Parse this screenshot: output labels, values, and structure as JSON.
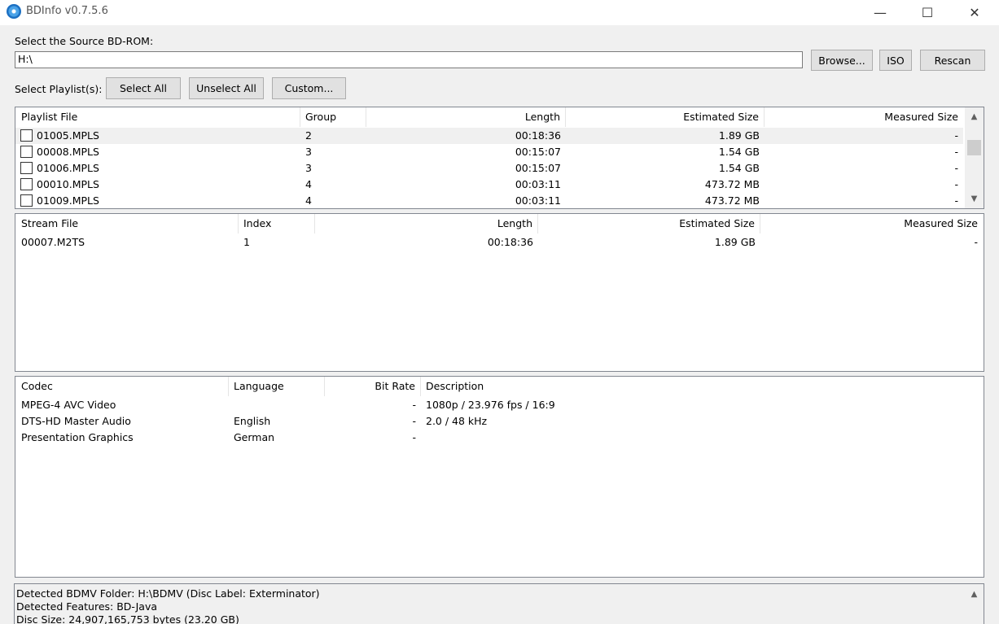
{
  "window": {
    "title": "BDInfo v0.7.5.6"
  },
  "source": {
    "label": "Select the Source BD-ROM:",
    "value": "H:\\",
    "browse": "Browse...",
    "iso": "ISO",
    "rescan": "Rescan"
  },
  "playlist_select": {
    "label": "Select Playlist(s):",
    "select_all": "Select All",
    "unselect_all": "Unselect All",
    "custom": "Custom..."
  },
  "playlists": {
    "headers": [
      "Playlist File",
      "Group",
      "Length",
      "Estimated Size",
      "Measured Size"
    ],
    "rows": [
      {
        "file": "01005.MPLS",
        "group": "2",
        "length": "00:18:36",
        "est": "1.89 GB",
        "meas": "-"
      },
      {
        "file": "00008.MPLS",
        "group": "3",
        "length": "00:15:07",
        "est": "1.54 GB",
        "meas": "-"
      },
      {
        "file": "01006.MPLS",
        "group": "3",
        "length": "00:15:07",
        "est": "1.54 GB",
        "meas": "-"
      },
      {
        "file": "00010.MPLS",
        "group": "4",
        "length": "00:03:11",
        "est": "473.72 MB",
        "meas": "-"
      },
      {
        "file": "01009.MPLS",
        "group": "4",
        "length": "00:03:11",
        "est": "473.72 MB",
        "meas": "-"
      }
    ]
  },
  "streams": {
    "headers": [
      "Stream File",
      "Index",
      "Length",
      "Estimated Size",
      "Measured Size"
    ],
    "rows": [
      {
        "file": "00007.M2TS",
        "index": "1",
        "length": "00:18:36",
        "est": "1.89 GB",
        "meas": "-"
      }
    ]
  },
  "codecs": {
    "headers": [
      "Codec",
      "Language",
      "Bit Rate",
      "Description"
    ],
    "rows": [
      {
        "codec": "MPEG-4 AVC Video",
        "lang": "",
        "rate": "-",
        "desc": "1080p / 23.976 fps / 16:9"
      },
      {
        "codec": "DTS-HD Master Audio",
        "lang": "English",
        "rate": "-",
        "desc": "2.0 / 48 kHz"
      },
      {
        "codec": "Presentation Graphics",
        "lang": "German",
        "rate": "-",
        "desc": ""
      }
    ]
  },
  "status": {
    "lines": [
      "Detected BDMV Folder: H:\\BDMV (Disc Label: Exterminator)",
      "Detected Features: BD-Java",
      "Disc Size: 24,907,165,753 bytes (23.20 GB)"
    ]
  },
  "icons": {
    "app": "bdinfo-disc-icon",
    "minimize": "—",
    "maximize": "☐",
    "close": "✕",
    "up": "▲",
    "down": "▼"
  }
}
